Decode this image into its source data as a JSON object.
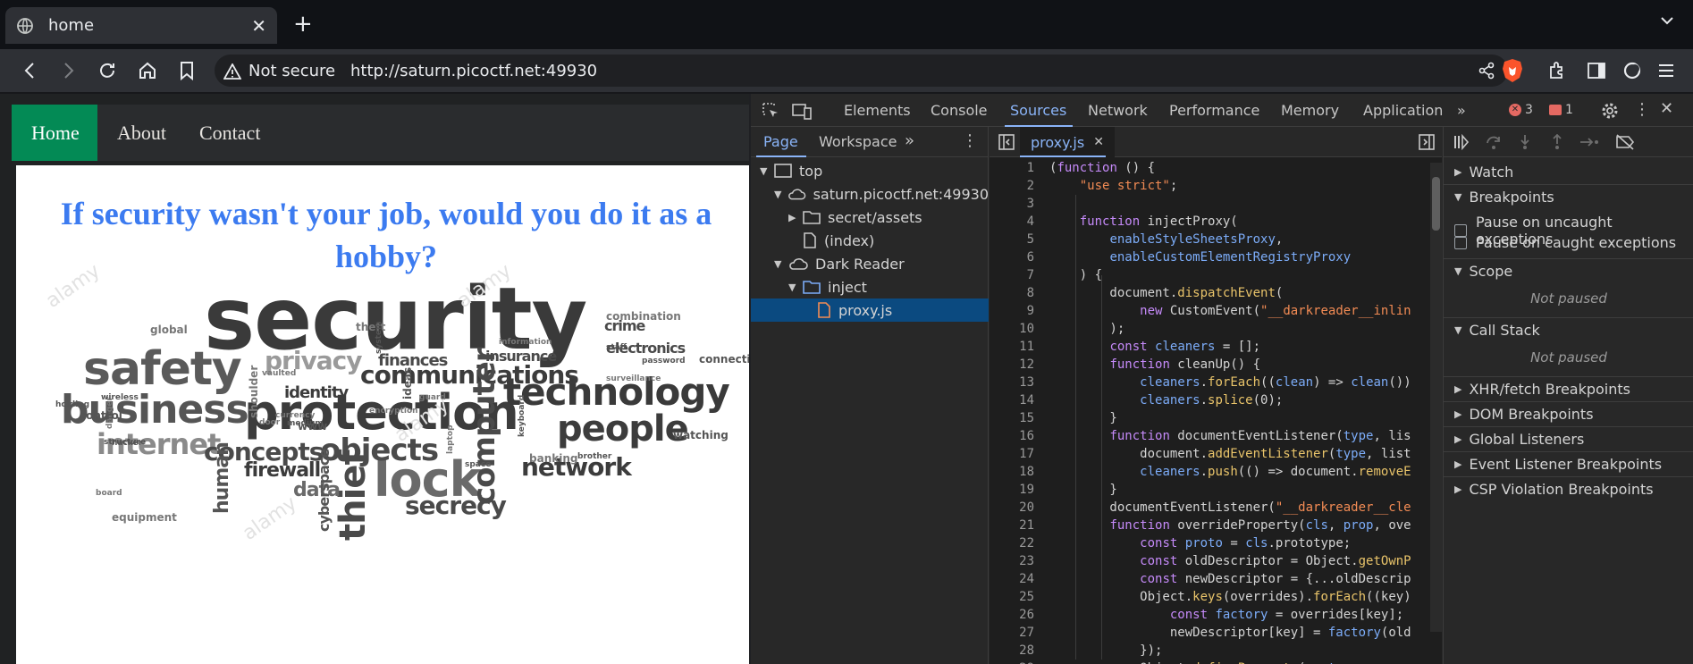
{
  "browser": {
    "tab_title": "home",
    "security_label": "Not secure",
    "url": "http://saturn.picoctf.net:49930"
  },
  "page": {
    "nav": [
      "Home",
      "About",
      "Contact"
    ],
    "headline": "If security wasn't your job, would you do it as a hobby?",
    "wordcloud": {
      "big": [
        "security",
        "safety",
        "protection",
        "business",
        "technology",
        "people",
        "lock",
        "internet",
        "communications",
        "objects",
        "concepts",
        "privacy",
        "network",
        "secrecy",
        "thief",
        "computer",
        "firewall",
        "identity",
        "finances",
        "insurance",
        "electronics",
        "crime",
        "data",
        "human",
        "cyberspace"
      ],
      "small": [
        "combination",
        "password",
        "surveillance",
        "watching",
        "laptop",
        "space",
        "global",
        "staff",
        "encryption",
        "ideas",
        "guard",
        "hacker",
        "equipment",
        "holding",
        "danger",
        "control",
        "door",
        "medium",
        "theft",
        "system",
        "information",
        "connection",
        "board",
        "structure",
        "shoulder",
        "wireless",
        "currency",
        "www",
        "vaulted",
        "keyboard",
        "banking",
        "brother"
      ],
      "watermark": "alamy"
    }
  },
  "devtools": {
    "tabs": [
      "Elements",
      "Console",
      "Sources",
      "Network",
      "Performance",
      "Memory",
      "Application"
    ],
    "error_count": "3",
    "issue_count": "1",
    "navigator_tabs": [
      "Page",
      "Workspace"
    ],
    "tree": [
      {
        "label": "top",
        "type": "frame"
      },
      {
        "label": "saturn.picoctf.net:49930",
        "type": "cloud"
      },
      {
        "label": "secret/assets",
        "type": "folder"
      },
      {
        "label": "(index)",
        "type": "file"
      },
      {
        "label": "Dark Reader",
        "type": "cloud"
      },
      {
        "label": "inject",
        "type": "folder"
      },
      {
        "label": "proxy.js",
        "type": "jsfile"
      }
    ],
    "open_file": "proxy.js",
    "code_lines": [
      {
        "n": "1",
        "t": "(function () {"
      },
      {
        "n": "2",
        "t": "    \"use strict\";"
      },
      {
        "n": "3",
        "t": ""
      },
      {
        "n": "4",
        "t": "    function injectProxy("
      },
      {
        "n": "5",
        "t": "        enableStyleSheetsProxy,"
      },
      {
        "n": "6",
        "t": "        enableCustomElementRegistryProxy"
      },
      {
        "n": "7",
        "t": "    ) {"
      },
      {
        "n": "8",
        "t": "        document.dispatchEvent("
      },
      {
        "n": "9",
        "t": "            new CustomEvent(\"__darkreader__inlin"
      },
      {
        "n": "10",
        "t": "        );"
      },
      {
        "n": "11",
        "t": "        const cleaners = [];"
      },
      {
        "n": "12",
        "t": "        function cleanUp() {"
      },
      {
        "n": "13",
        "t": "            cleaners.forEach((clean) => clean())"
      },
      {
        "n": "14",
        "t": "            cleaners.splice(0);"
      },
      {
        "n": "15",
        "t": "        }"
      },
      {
        "n": "16",
        "t": "        function documentEventListener(type, lis"
      },
      {
        "n": "17",
        "t": "            document.addEventListener(type, list"
      },
      {
        "n": "18",
        "t": "            cleaners.push(() => document.removeE"
      },
      {
        "n": "19",
        "t": "        }"
      },
      {
        "n": "20",
        "t": "        documentEventListener(\"__darkreader__cle"
      },
      {
        "n": "21",
        "t": "        function overrideProperty(cls, prop, ove"
      },
      {
        "n": "22",
        "t": "            const proto = cls.prototype;"
      },
      {
        "n": "23",
        "t": "            const oldDescriptor = Object.getOwnP"
      },
      {
        "n": "24",
        "t": "            const newDescriptor = {...oldDescrip"
      },
      {
        "n": "25",
        "t": "            Object.keys(overrides).forEach((key)"
      },
      {
        "n": "26",
        "t": "                const factory = overrides[key];"
      },
      {
        "n": "27",
        "t": "                newDescriptor[key] = factory(old"
      },
      {
        "n": "28",
        "t": "            });"
      },
      {
        "n": "29",
        "t": "            Object.defineProperty(proto, prop, n"
      }
    ],
    "debugger": {
      "watch": "Watch",
      "breakpoints": "Breakpoints",
      "pause_uncaught": "Pause on uncaught exceptions",
      "pause_caught": "Pause on caught exceptions",
      "scope": "Scope",
      "scope_status": "Not paused",
      "call_stack": "Call Stack",
      "call_stack_status": "Not paused",
      "xhr": "XHR/fetch Breakpoints",
      "dom": "DOM Breakpoints",
      "global": "Global Listeners",
      "event": "Event Listener Breakpoints",
      "csp": "CSP Violation Breakpoints"
    }
  }
}
